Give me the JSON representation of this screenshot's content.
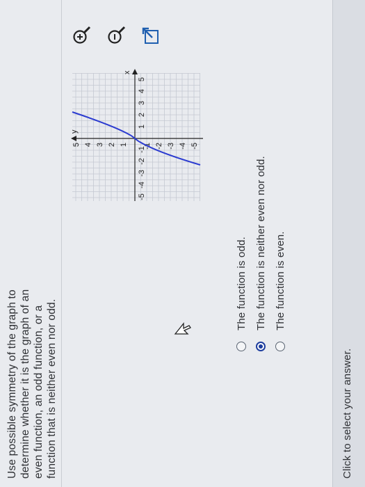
{
  "question": {
    "lines": [
      "Use possible symmetry of the graph to",
      "determine whether it is the graph of an",
      "even function, an odd function, or a",
      "function that is neither even nor odd."
    ]
  },
  "graph": {
    "x_axis_label": "x",
    "y_axis_label": "y",
    "x_ticks": [
      "-5",
      "-4",
      "-3",
      "-2",
      "-1",
      "1",
      "2",
      "3",
      "4",
      "5"
    ],
    "y_ticks": [
      "5",
      "4",
      "3",
      "2",
      "1",
      "-1",
      "-2",
      "-3",
      "-4",
      "-5"
    ],
    "curve_color": "#2b3bd0",
    "icons": [
      "zoom-in-icon",
      "zoom-out-icon",
      "external-link-icon"
    ]
  },
  "options": [
    {
      "label": "The function is odd.",
      "selected": false
    },
    {
      "label": "The function is neither even nor odd.",
      "selected": true
    },
    {
      "label": "The function is even.",
      "selected": false
    }
  ],
  "footer": {
    "text": "Click to select your answer."
  }
}
